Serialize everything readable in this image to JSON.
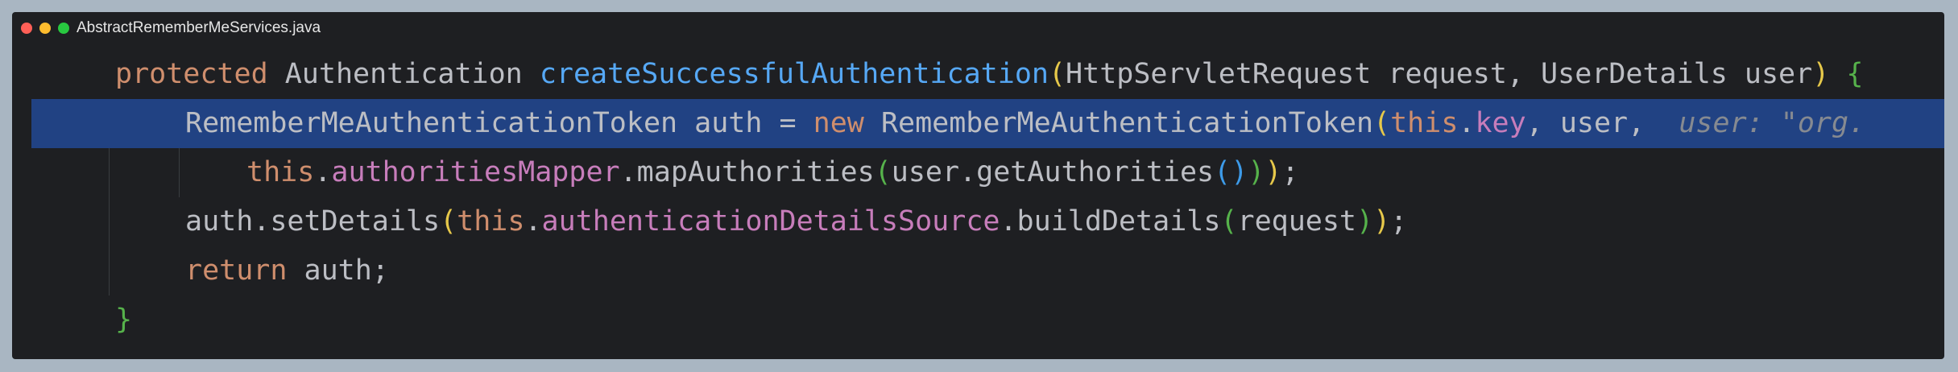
{
  "window": {
    "filename": "AbstractRememberMeServices.java"
  },
  "code": {
    "line1": {
      "t1": "protected",
      "t2": " Authentication ",
      "t3": "createSuccessfulAuthentication",
      "t4": "(",
      "t5": "HttpServletRequest request, UserDetails user",
      "t6": ")",
      "t7": " ",
      "t8": "{"
    },
    "line2": {
      "t1": "RememberMeAuthenticationToken auth = ",
      "t2": "new",
      "t3": " RememberMeAuthenticationToken",
      "t4": "(",
      "t5": "this",
      "t6": ".",
      "t7": "key",
      "t8": ", user,  ",
      "t9": "user: \"org."
    },
    "line3": {
      "t1": "this",
      "t2": ".",
      "t3": "authoritiesMapper",
      "t4": ".mapAuthorities",
      "t5": "(",
      "t6": "user.getAuthorities",
      "t7": "(",
      "t8": ")",
      "t9": ")",
      "t10": ")",
      "t11": ";"
    },
    "line4": {
      "t1": "auth.setDetails",
      "t2": "(",
      "t3": "this",
      "t4": ".",
      "t5": "authenticationDetailsSource",
      "t6": ".buildDetails",
      "t7": "(",
      "t8": "request",
      "t9": ")",
      "t10": ")",
      "t11": ";"
    },
    "line5": {
      "t1": "return",
      "t2": " auth;"
    },
    "line6": {
      "t1": "}"
    }
  },
  "colors": {
    "background": "#1e1f22",
    "selection": "#214283",
    "keyword": "#cf8e6d",
    "method": "#56a8f5",
    "field": "#c77dbb",
    "brace_level1": "#e6c84a",
    "brace_level2": "#56b24b",
    "brace_level3": "#3d9be9"
  }
}
